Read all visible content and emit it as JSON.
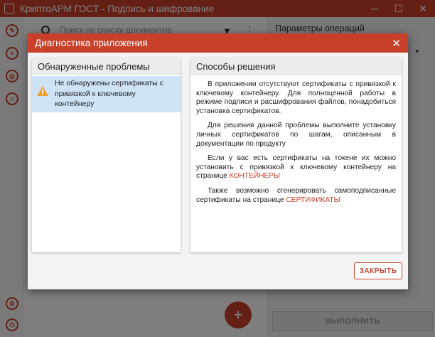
{
  "window": {
    "title": "КриптоАРМ ГОСТ - Подпись и шифрование",
    "minimize": "─",
    "maximize": "☐",
    "close": "✕"
  },
  "background": {
    "search_placeholder": "Поиск по списку документов",
    "params_title": "Параметры операций",
    "run_button": "ВЫПОЛНИТЬ",
    "fab_label": "+"
  },
  "dialog": {
    "title": "Диагностика приложения",
    "close_symbol": "✕",
    "problems": {
      "header": "Обнаруженные проблемы",
      "items": [
        {
          "text": "Не обнаружены сертификаты с привязкой к ключевому контейнеру"
        }
      ]
    },
    "solutions": {
      "header": "Способы решения",
      "p1": "В приложении отсутствуют сертификаты с привязкой к ключевому контейнеру. Для полноценной работы в режиме подписи и расшифрования файлов, понадобиться установка сертификатов.",
      "p2": "Для решения данной проблемы выполните установку личных сертификатов по шагам, описанным в документации по продукту",
      "p3_text": "Если у вас есть сертификаты на токене их можно установить с привязкой к ключевому контейнеру на странице ",
      "p3_link": "КОНТЕЙНЕРЫ",
      "p4_text": "Также возможно сгенерировать самоподписанные сертификаты на странице ",
      "p4_link": "СЕРТИФИКАТЫ"
    },
    "close_button": "ЗАКРЫТЬ"
  },
  "colors": {
    "accent": "#c8402a",
    "selection": "#cfe3f6",
    "warning": "#f0a030"
  }
}
